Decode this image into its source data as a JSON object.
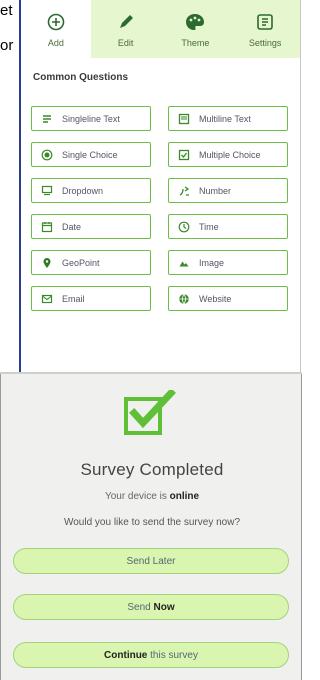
{
  "clipped_text": {
    "line1": "et",
    "line2": "or"
  },
  "tabs": [
    {
      "label": "Add",
      "icon": "add-circle-icon",
      "active": true
    },
    {
      "label": "Edit",
      "icon": "pencil-icon",
      "active": false
    },
    {
      "label": "Theme",
      "icon": "palette-icon",
      "active": false
    },
    {
      "label": "Settings",
      "icon": "settings-icon",
      "active": false
    }
  ],
  "section_title": "Common Questions",
  "questions": [
    {
      "label": "Singleline Text",
      "icon": "singleline-text-icon"
    },
    {
      "label": "Multiline Text",
      "icon": "multiline-text-icon"
    },
    {
      "label": "Single Choice",
      "icon": "radio-icon"
    },
    {
      "label": "Multiple Choice",
      "icon": "checkbox-icon"
    },
    {
      "label": "Dropdown",
      "icon": "dropdown-icon"
    },
    {
      "label": "Number",
      "icon": "number-icon"
    },
    {
      "label": "Date",
      "icon": "calendar-icon"
    },
    {
      "label": "Time",
      "icon": "clock-icon"
    },
    {
      "label": "GeoPoint",
      "icon": "map-pin-icon"
    },
    {
      "label": "Image",
      "icon": "camera-icon"
    },
    {
      "label": "Email",
      "icon": "envelope-icon"
    },
    {
      "label": "Website",
      "icon": "globe-icon"
    }
  ],
  "completed": {
    "title": "Survey Completed",
    "status_prefix": "Your device is ",
    "status_value": "online",
    "question": "Would you like to send the survey now?",
    "send_later": "Send Later",
    "send_now_prefix": "Send ",
    "send_now_bold": "Now",
    "continue_bold": "Continue",
    "continue_rest": " this survey"
  },
  "colors": {
    "accent": "#6cbf46",
    "tab_bg": "#e6f6cf",
    "pill_bg": "#d9f5b0"
  }
}
